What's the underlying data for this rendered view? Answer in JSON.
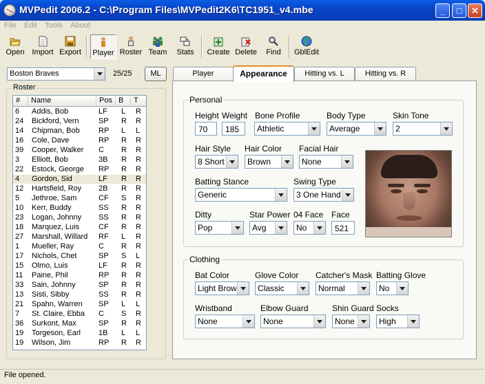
{
  "window": {
    "title": "MVPedit 2006.2 - C:\\Program Files\\MVPedit2K6\\TC1951_v4.mbe",
    "minimize": "_",
    "maximize": "□",
    "close": "✕"
  },
  "menu": [
    "File",
    "Edit",
    "Tools",
    "About"
  ],
  "toolbar": {
    "open": "Open",
    "import": "Import",
    "export": "Export",
    "player": "Player",
    "roster": "Roster",
    "team": "Team",
    "stats": "Stats",
    "create": "Create",
    "delete": "Delete",
    "find": "Find",
    "gbledit": "GblEdit"
  },
  "team_select": "Boston Braves",
  "roster_count": "25/25",
  "ml_button": "ML",
  "roster": {
    "title": "Roster",
    "columns": [
      "#",
      "Name",
      "Pos",
      "B",
      "T"
    ],
    "rows": [
      [
        "6",
        "Addis, Bob",
        "LF",
        "L",
        "R"
      ],
      [
        "24",
        "Bickford, Vern",
        "SP",
        "R",
        "R"
      ],
      [
        "14",
        "Chipman, Bob",
        "RP",
        "L",
        "L"
      ],
      [
        "16",
        "Cole, Dave",
        "RP",
        "R",
        "R"
      ],
      [
        "39",
        "Cooper, Walker",
        "C",
        "R",
        "R"
      ],
      [
        "3",
        "Elliott, Bob",
        "3B",
        "R",
        "R"
      ],
      [
        "22",
        "Estock, George",
        "RP",
        "R",
        "R"
      ],
      [
        "4",
        "Gordon, Sid",
        "LF",
        "R",
        "R"
      ],
      [
        "12",
        "Hartsfield, Roy",
        "2B",
        "R",
        "R"
      ],
      [
        "5",
        "Jethroe, Sam",
        "CF",
        "S",
        "R"
      ],
      [
        "10",
        "Kerr, Buddy",
        "SS",
        "R",
        "R"
      ],
      [
        "23",
        "Logan, Johnny",
        "SS",
        "R",
        "R"
      ],
      [
        "18",
        "Marquez, Luis",
        "CF",
        "R",
        "R"
      ],
      [
        "27",
        "Marshall, Willard",
        "RF",
        "L",
        "R"
      ],
      [
        "1",
        "Mueller, Ray",
        "C",
        "R",
        "R"
      ],
      [
        "17",
        "Nichols, Chet",
        "SP",
        "S",
        "L"
      ],
      [
        "15",
        "Olmo, Luis",
        "LF",
        "R",
        "R"
      ],
      [
        "11",
        "Paine, Phil",
        "RP",
        "R",
        "R"
      ],
      [
        "33",
        "Sain, Johnny",
        "SP",
        "R",
        "R"
      ],
      [
        "13",
        "Sisti, Sibby",
        "SS",
        "R",
        "R"
      ],
      [
        "21",
        "Spahn, Warren",
        "SP",
        "L",
        "L"
      ],
      [
        "7",
        "St. Claire, Ebba",
        "C",
        "S",
        "R"
      ],
      [
        "36",
        "Surkont, Max",
        "SP",
        "R",
        "R"
      ],
      [
        "19",
        "Torgeson, Earl",
        "1B",
        "L",
        "L"
      ],
      [
        "19",
        "Wilson, Jim",
        "RP",
        "R",
        "R"
      ]
    ]
  },
  "tabs": [
    "Player",
    "Appearance",
    "Hitting vs. L",
    "Hitting vs. R"
  ],
  "personal": {
    "title": "Personal",
    "height_label": "Height",
    "height": "70",
    "weight_label": "Weight",
    "weight": "185",
    "bone_profile_label": "Bone Profile",
    "bone_profile": "Athletic",
    "body_type_label": "Body Type",
    "body_type": "Average",
    "skin_tone_label": "Skin Tone",
    "skin_tone": "2",
    "hair_style_label": "Hair Style",
    "hair_style": "8 Short H",
    "hair_color_label": "Hair Color",
    "hair_color": "Brown",
    "facial_hair_label": "Facial Hair",
    "facial_hair": "None",
    "batting_stance_label": "Batting Stance",
    "batting_stance": "Generic",
    "swing_type_label": "Swing Type",
    "swing_type": "3 One Hand",
    "ditty_label": "Ditty",
    "ditty": "Pop",
    "star_power_label": "Star Power",
    "star_power": "Avg",
    "face04_label": "04 Face",
    "face04": "No",
    "face_label": "Face",
    "face": "521"
  },
  "clothing": {
    "title": "Clothing",
    "bat_color_label": "Bat Color",
    "bat_color": "Light Brown",
    "glove_color_label": "Glove Color",
    "glove_color": "Classic",
    "catchers_mask_label": "Catcher's Mask",
    "catchers_mask": "Normal",
    "batting_glove_label": "Batting Glove",
    "batting_glove": "No",
    "wristband_label": "Wristband",
    "wristband": "None",
    "elbow_guard_label": "Elbow Guard",
    "elbow_guard": "None",
    "shin_guard_label": "Shin Guard",
    "shin_guard": "None",
    "socks_label": "Socks",
    "socks": "High"
  },
  "status": "File opened."
}
